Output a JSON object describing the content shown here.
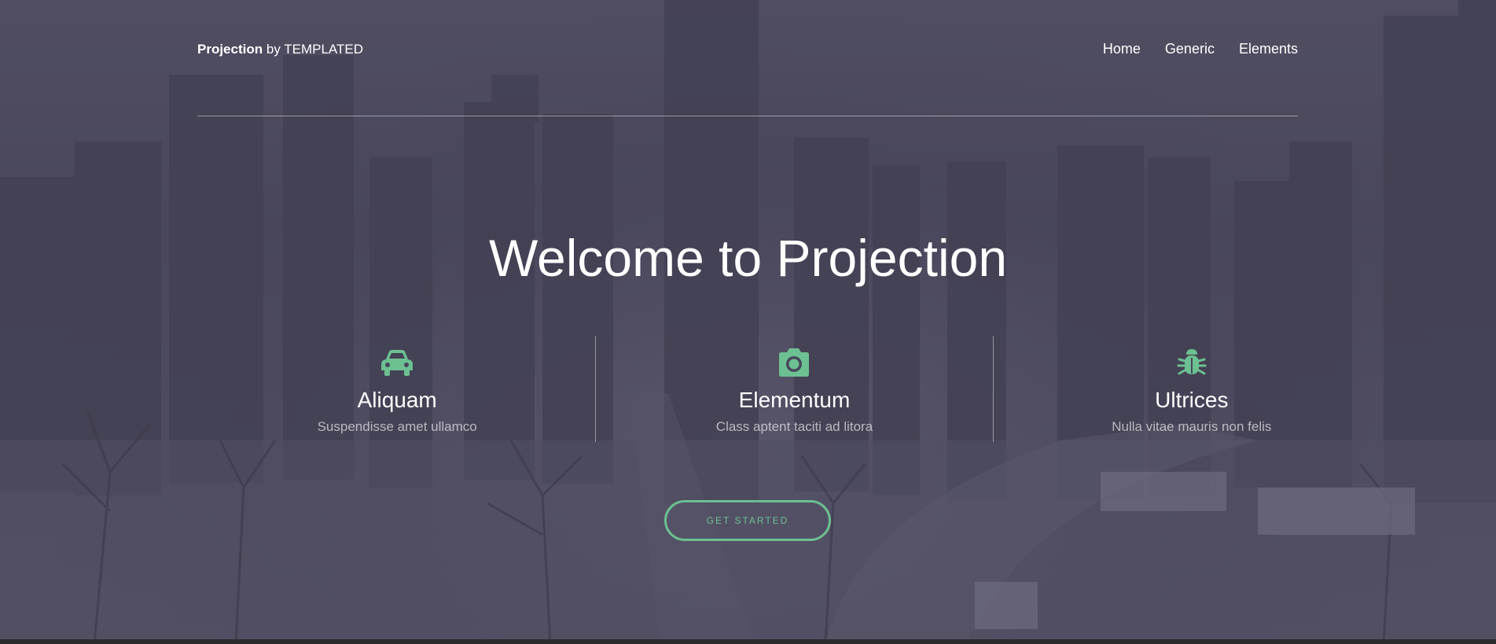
{
  "header": {
    "logo_name": "Projection",
    "logo_by": "by TEMPLATED",
    "nav": [
      {
        "label": "Home"
      },
      {
        "label": "Generic"
      },
      {
        "label": "Elements"
      }
    ]
  },
  "hero": {
    "title": "Welcome to Projection"
  },
  "features": [
    {
      "icon": "car-icon",
      "title": "Aliquam",
      "description": "Suspendisse amet ullamco"
    },
    {
      "icon": "camera-icon",
      "title": "Elementum",
      "description": "Class aptent taciti ad litora"
    },
    {
      "icon": "bug-icon",
      "title": "Ultrices",
      "description": "Nulla vitae mauris non felis"
    }
  ],
  "cta": {
    "label": "Get Started"
  },
  "colors": {
    "accent": "#6cc091",
    "overlay": "#48465c",
    "text": "#ffffff"
  }
}
